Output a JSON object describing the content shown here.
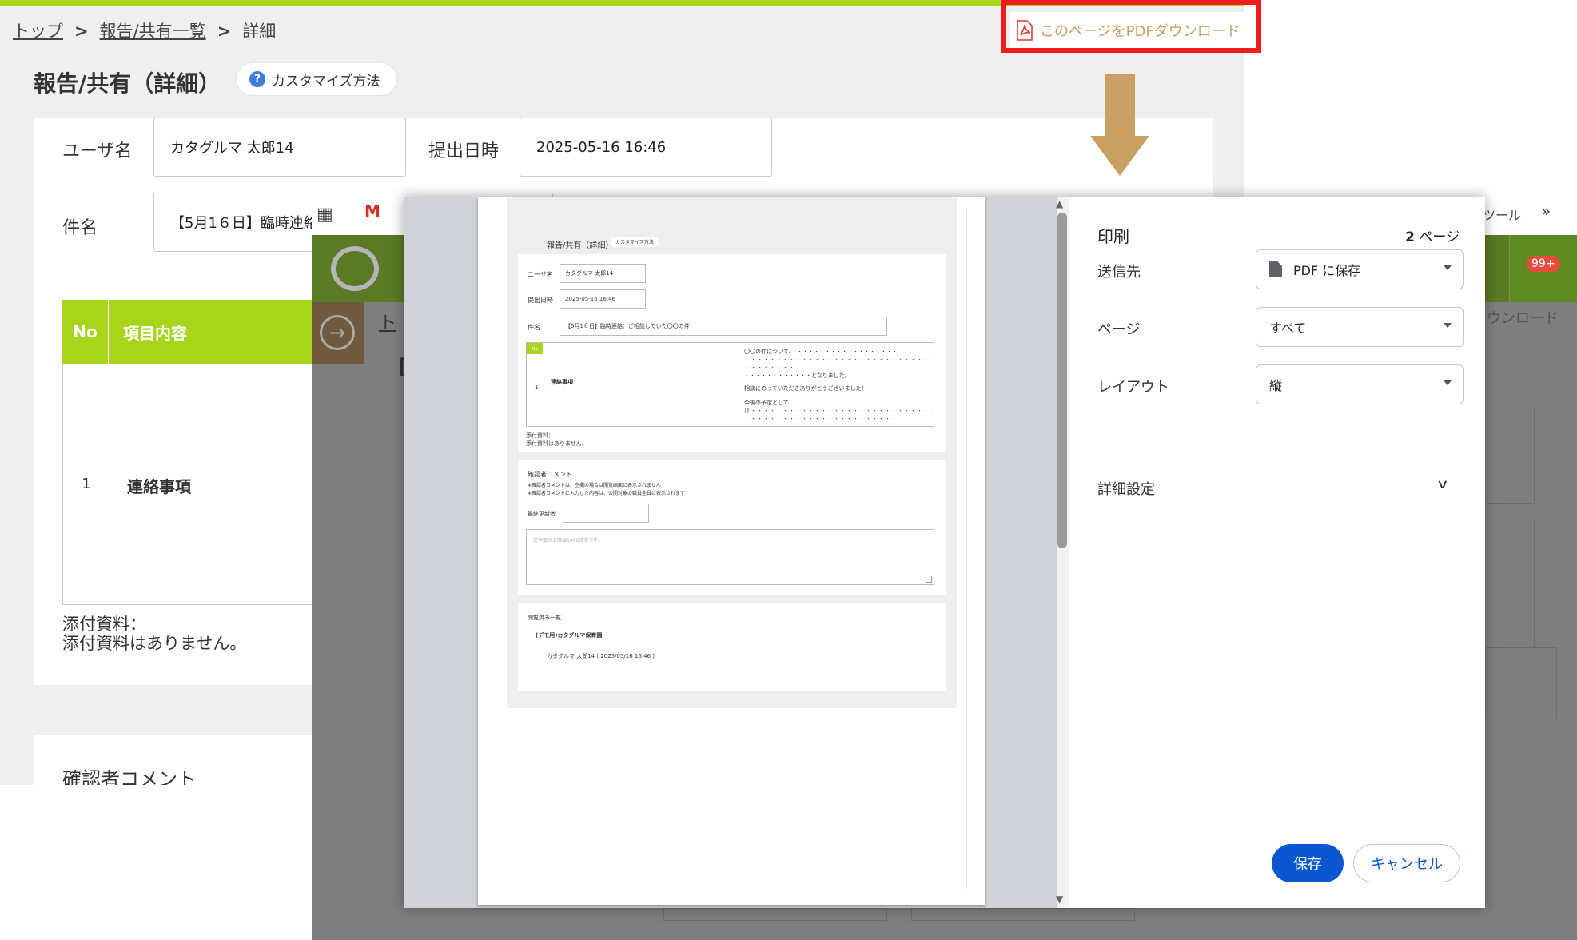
{
  "breadcrumb": {
    "top": "トップ",
    "list": "報告/共有一覧",
    "current": "詳細",
    "separator": ">"
  },
  "header": {
    "title": "報告/共有（詳細）",
    "help_label": "カスタマイズ方法",
    "help_icon": "question-circle-icon",
    "pdf_download_label": "このページをPDFダウンロード",
    "pdf_icon": "pdf-file-icon"
  },
  "form": {
    "user_label": "ユーザ名",
    "user_value": "カタグルマ 太郎14",
    "date_label": "提出日時",
    "date_value": "2025-05-16 16:46",
    "subject_label": "件名",
    "subject_value": "【5月1６日】臨時連絡：ご相談していた〇〇の件"
  },
  "table": {
    "headers": [
      "No",
      "項目内容"
    ],
    "rows": [
      {
        "no": "1",
        "item": "連絡事項"
      }
    ]
  },
  "attachments": {
    "label": "添付資料：",
    "empty": "添付資料はありません。"
  },
  "comment_section": {
    "title": "確認者コメント"
  },
  "colors": {
    "accent_green": "#a8d51c",
    "highlight_red": "#ee1c1c",
    "arrow_gold": "#c9a062",
    "primary_blue": "#0b57d0"
  },
  "background_app": {
    "bookmark_tool": "ツール",
    "bookmark_more": "»",
    "mail_glyph": "M",
    "crumb_fragment": "ト",
    "title_fragment": "[",
    "badge": "99+",
    "download_fragment": "ウンロード"
  },
  "print_dialog": {
    "title": "印刷",
    "page_count": "2",
    "page_unit": " ページ",
    "destination_label": "送信先",
    "destination_value": "PDF に保存",
    "pages_label": "ページ",
    "pages_value": "すべて",
    "layout_label": "レイアウト",
    "layout_value": "縦",
    "advanced_label": "詳細設定",
    "save_button": "保存",
    "cancel_button": "キャンセル"
  },
  "preview": {
    "title": "報告/共有（詳細）",
    "help_label": "カスタマイズ方法",
    "user_label": "ユーザ名",
    "user_value": "カタグルマ 太郎14",
    "date_label": "提出日時",
    "date_value": "2025-05-16 16:46",
    "subject_label": "件名",
    "subject_value": "【5月1６日】臨時連絡：ご相談していた〇〇の件",
    "table_header": "No",
    "row_no": "1",
    "row_item": "連絡事項",
    "content_line1": "〇〇の件について、・・・・・・・・・・・・・・・・・・・",
    "content_dots": "・・・・・・・・・・・・・・・・・・・・・・・・・・・・・・・",
    "content_dots_short": "・・・・・・・・・",
    "content_line2": "・・・・・・・・・・・・となりました。",
    "content_line3": "相談にのっていただきありがとうございました！",
    "content_line4": "今後の予定として",
    "content_line5": "は・・・・・・・・・・・・・・・・・・・・・・・・・・・・・",
    "content_dots2": "・・・・・・・・・・・・・・・・・・・・・・・・・",
    "attach_label": "添付資料：",
    "attach_empty": "添付資料はありません。",
    "comment_title": "確認者コメント",
    "comment_note1": "※確認者コメントは、空欄の場合は閲覧画面に表示されません",
    "comment_note2": "※確認者コメントに入力した内容は、公開対象の職員全員に表示されます",
    "last_editor_label": "最終更新者",
    "textarea_placeholder": "文字数の上限は1000文字です。",
    "viewed_title": "閲覧済み一覧",
    "viewed_org": "(デモ用)カタグルマ保育園",
    "viewed_user": "カタグルマ 太郎14 ( 2025/05/16 16:46 )"
  }
}
